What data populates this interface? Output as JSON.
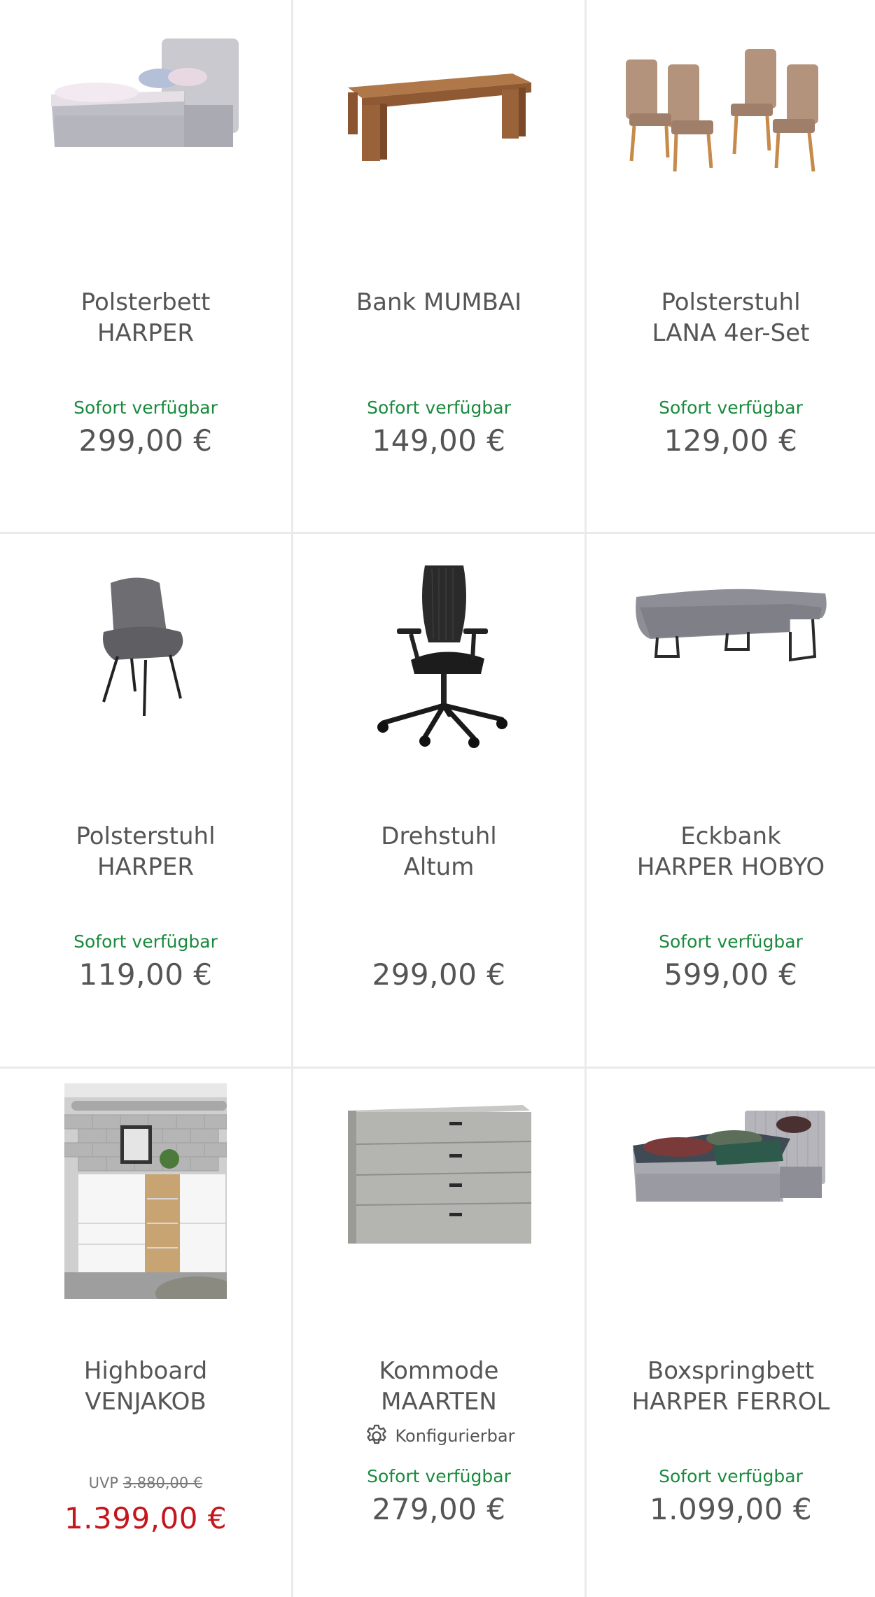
{
  "products": [
    {
      "title_lines": [
        "Polsterbett",
        "HARPER"
      ],
      "availability": "Sofort verfügbar",
      "price": "299,00 €",
      "image": "upholstered-bed"
    },
    {
      "title_lines": [
        "Bank MUMBAI"
      ],
      "availability": "Sofort verfügbar",
      "price": "149,00 €",
      "image": "wooden-bench"
    },
    {
      "title_lines": [
        "Polsterstuhl",
        "LANA 4er-Set"
      ],
      "availability": "Sofort verfügbar",
      "price": "129,00 €",
      "image": "chair-set"
    },
    {
      "title_lines": [
        "Polsterstuhl",
        "HARPER"
      ],
      "availability": "Sofort verfügbar",
      "price": "119,00 €",
      "image": "upholstered-chair"
    },
    {
      "title_lines": [
        "Drehstuhl",
        "Altum"
      ],
      "availability": "",
      "price": "299,00 €",
      "image": "office-chair"
    },
    {
      "title_lines": [
        "Eckbank",
        "HARPER HOBYO"
      ],
      "availability": "Sofort verfügbar",
      "price": "599,00 €",
      "image": "corner-bench"
    },
    {
      "title_lines": [
        "Highboard",
        "VENJAKOB"
      ],
      "availability": "",
      "uvp_label": "UVP",
      "uvp_price": "3.880,00 €",
      "price": "1.399,00 €",
      "sale": true,
      "image": "highboard-room"
    },
    {
      "title_lines": [
        "Kommode",
        "MAARTEN"
      ],
      "configurable": "Konfigurierbar",
      "availability": "Sofort verfügbar",
      "price": "279,00 €",
      "image": "chest-of-drawers"
    },
    {
      "title_lines": [
        "Boxspringbett",
        "HARPER FERROL"
      ],
      "availability": "Sofort verfügbar",
      "price": "1.099,00 €",
      "image": "boxspring-bed"
    }
  ],
  "colors": {
    "available": "#1b8a3e",
    "sale": "#c4161c",
    "text": "#555555",
    "divider": "#e9eaec"
  }
}
